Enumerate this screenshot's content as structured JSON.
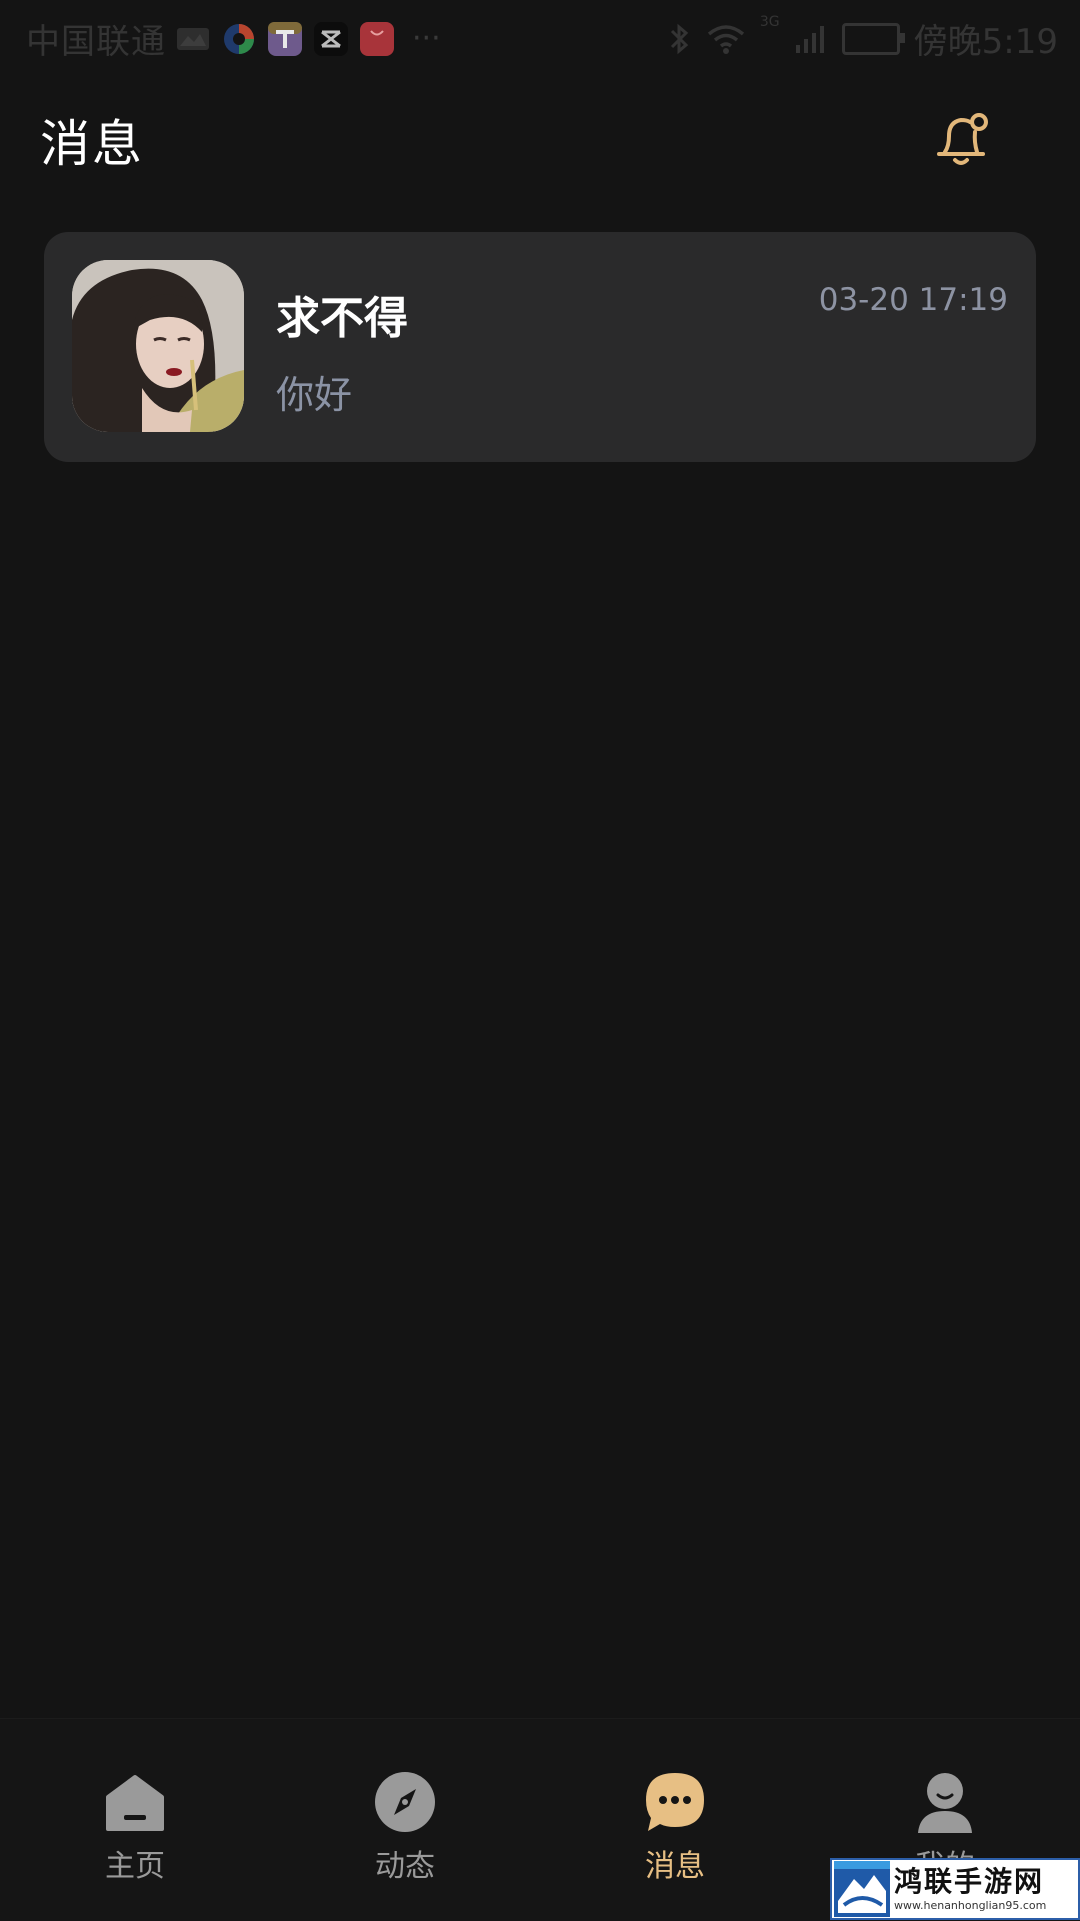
{
  "status_bar": {
    "carrier": "中国联通",
    "time": "傍晚5:19",
    "network": "3G",
    "more": "···"
  },
  "header": {
    "title": "消息",
    "bell_icon": "notification-bell-icon"
  },
  "conversations": [
    {
      "name": "求不得",
      "time": "03-20 17:19",
      "preview": "你好",
      "avatar": "user-avatar-photo"
    }
  ],
  "bottom_nav": {
    "items": [
      {
        "label": "主页",
        "icon": "home-icon",
        "active": false
      },
      {
        "label": "动态",
        "icon": "compass-icon",
        "active": false
      },
      {
        "label": "消息",
        "icon": "chat-bubble-icon",
        "active": true
      },
      {
        "label": "我的",
        "icon": "person-icon",
        "active": false
      }
    ]
  },
  "watermark": {
    "title": "鸿联手游网",
    "url": "www.henanhonglian95.com"
  },
  "colors": {
    "background": "#141414",
    "card": "#2a2a2b",
    "accent": "#e7bf84",
    "muted": "#8b93a5"
  }
}
